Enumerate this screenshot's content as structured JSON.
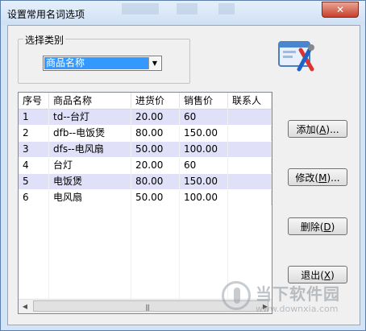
{
  "window": {
    "title": "设置常用名词选项",
    "close_label": "✕"
  },
  "category": {
    "group_label": "选择类别",
    "selected": "商品名称"
  },
  "table": {
    "columns": [
      "序号",
      "商品名称",
      "进货价",
      "销售价",
      "联系人"
    ],
    "rows": [
      {
        "no": "1",
        "name": "td--台灯",
        "buy": "20.00",
        "sell": "60",
        "contact": "",
        "highlight": true
      },
      {
        "no": "2",
        "name": "dfb--电饭煲",
        "buy": "80.00",
        "sell": "150.00",
        "contact": "",
        "highlight": false
      },
      {
        "no": "3",
        "name": "dfs--电风扇",
        "buy": "50.00",
        "sell": "100.00",
        "contact": "",
        "highlight": true
      },
      {
        "no": "4",
        "name": "台灯",
        "buy": "20.00",
        "sell": "60",
        "contact": "",
        "highlight": false
      },
      {
        "no": "5",
        "name": "电饭煲",
        "buy": "80.00",
        "sell": "150.00",
        "contact": "",
        "highlight": true
      },
      {
        "no": "6",
        "name": "电风扇",
        "buy": "50.00",
        "sell": "100.00",
        "contact": "",
        "highlight": false
      }
    ]
  },
  "buttons": {
    "add": {
      "text": "添加(",
      "key": "A",
      "suffix": ")..."
    },
    "edit": {
      "text": "修改(",
      "key": "M",
      "suffix": ")..."
    },
    "delete": {
      "text": "删除(",
      "key": "D",
      "suffix": ")"
    },
    "exit": {
      "text": "退出(",
      "key": "X",
      "suffix": ")"
    }
  },
  "watermark": {
    "text": "当下软件园",
    "url": "www.downxia.com"
  },
  "colors": {
    "selection": "#3399ff",
    "alt_row": "#e0e0f8",
    "close": "#c8402a"
  },
  "icons": {
    "settings": "tools-settings-icon",
    "dropdown": "chevron-down-icon"
  }
}
